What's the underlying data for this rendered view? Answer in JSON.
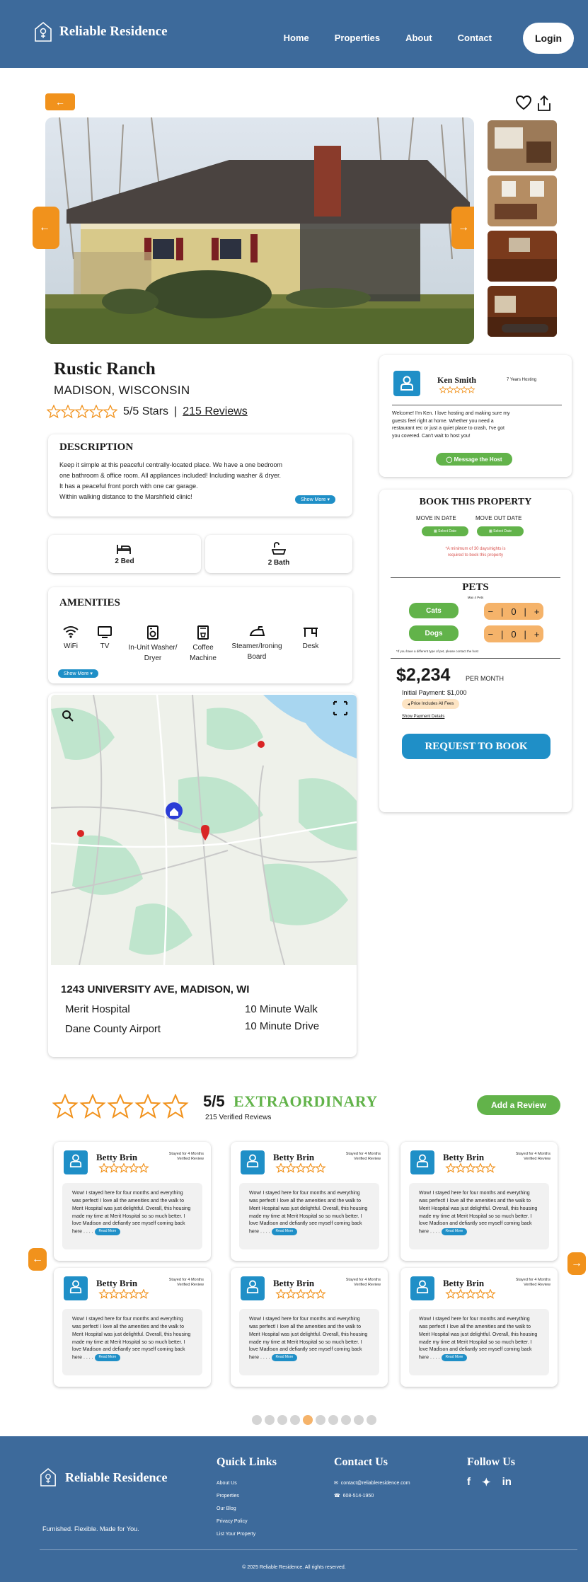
{
  "brand": "Reliable Residence",
  "nav": {
    "links": [
      "Home",
      "Properties",
      "About",
      "Contact"
    ],
    "login": "Login"
  },
  "property": {
    "name": "Rustic Ranch",
    "location": "MADISON, WISCONSIN",
    "stars_text": "5/5 Stars",
    "reviews_link": "215 Reviews",
    "rating": 5
  },
  "description": {
    "heading": "DESCRIPTION",
    "lines": [
      "Keep it simple at this peaceful centrally-located place. We have a one bedroom",
      "one bathroom & office room. All appliances included! Including washer & dryer.",
      "It has a peaceful front porch with one car garage.",
      "Within walking distance to the Marshfield clinic!"
    ],
    "show_more": "Show More"
  },
  "rooms": {
    "bed": "2 Bed",
    "bath": "2 Bath"
  },
  "amenities": {
    "heading": "AMENITIES",
    "items": [
      {
        "icon": "wifi-icon",
        "label": "WiFi"
      },
      {
        "icon": "tv-icon",
        "label": "TV"
      },
      {
        "icon": "washer-icon",
        "label": "In-Unit Washer/ Dryer"
      },
      {
        "icon": "coffee-machine-icon",
        "label": "Coffee Machine"
      },
      {
        "icon": "iron-icon",
        "label": "Steamer/Ironing Board"
      },
      {
        "icon": "desk-icon",
        "label": "Desk"
      }
    ],
    "show_more": "Show More"
  },
  "map": {
    "address": "1243 UNIVERSITY AVE, MADISON, WI",
    "places": [
      {
        "name": "Merit Hospital",
        "distance": "10 Minute Walk"
      },
      {
        "name": "Dane County Airport",
        "distance": "10 Minute Drive"
      }
    ]
  },
  "host": {
    "name": "Ken Smith",
    "hosting": "7 Years Hosting",
    "bio": [
      "Welcome! I'm Ken. I love hosting and making sure my",
      "guests feel right at home. Whether you need a",
      "restaurant rec or just a quiet place to crash, I've got",
      "you covered. Can't wait to host you!"
    ],
    "message": "Message the Host"
  },
  "booking": {
    "heading": "BOOK THIS PROPERTY",
    "move_in": "MOVE IN DATE",
    "move_out": "MOVE OUT DATE",
    "select_date": "Select Date",
    "minimum": [
      "*A minimum of 30 days/nights is",
      "required to book this property"
    ],
    "pets_heading": "PETS",
    "pets_sub": "Max 4 Pets",
    "pets": [
      {
        "label": "Cats",
        "count": "0"
      },
      {
        "label": "Dogs",
        "count": "0"
      }
    ],
    "pets_note": "*If you have a different type of pet, please contact the host",
    "price": "$2,234",
    "per": "PER MONTH",
    "initial": "Initial Payment: $1,000",
    "fees": "Price Includes All Fees",
    "payment_details": "Show Payment Details",
    "request": "REQUEST TO BOOK"
  },
  "reviews": {
    "score": "5/5",
    "label": "EXTRAORDINARY",
    "verified": "215 Verified Reviews",
    "add": "Add a Review",
    "cards": [
      {
        "name": "Betty Brin",
        "stay": "Stayed for 4 Months Verified Review",
        "text": "Wow! I stayed here for four months and everything was perfect! I love all the amenities and the walk to Merit Hospital was just delightful. Overall, this housing made my time at Merit Hospital so so much better. I love Madison and defiantly see myself coming back here . . . .",
        "more": "Read More"
      },
      {
        "name": "Betty Brin",
        "stay": "Stayed for 4 Months Verified Review",
        "text": "Wow! I stayed here for four months and everything was perfect! I love all the amenities and the walk to Merit Hospital was just delightful. Overall, this housing made my time at Merit Hospital so so much better. I love Madison and defiantly see myself coming back here . . . .",
        "more": "Read More"
      },
      {
        "name": "Betty Brin",
        "stay": "Stayed for 4 Months Verified Review",
        "text": "Wow! I stayed here for four months and everything was perfect! I love all the amenities and the walk to Merit Hospital was just delightful. Overall, this housing made my time at Merit Hospital so so much better. I love Madison and defiantly see myself coming back here . . . .",
        "more": "Read More"
      },
      {
        "name": "Betty Brin",
        "stay": "Stayed for 4 Months Verified Review",
        "text": "Wow! I stayed here for four months and everything was perfect! I love all the amenities and the walk to Merit Hospital was just delightful. Overall, this housing made my time at Merit Hospital so so much better. I love Madison and defiantly see myself coming back here . . . .",
        "more": "Read More"
      },
      {
        "name": "Betty Brin",
        "stay": "Stayed for 4 Months Verified Review",
        "text": "Wow! I stayed here for four months and everything was perfect! I love all the amenities and the walk to Merit Hospital was just delightful. Overall, this housing made my time at Merit Hospital so so much better. I love Madison and defiantly see myself coming back here . . . .",
        "more": "Read More"
      },
      {
        "name": "Betty Brin",
        "stay": "Stayed for 4 Months Verified Review",
        "text": "Wow! I stayed here for four months and everything was perfect! I love all the amenities and the walk to Merit Hospital was just delightful. Overall, this housing made my time at Merit Hospital so so much better. I love Madison and defiantly see myself coming back here . . . .",
        "more": "Read More"
      }
    ],
    "page_count": 10,
    "active_page": 4
  },
  "footer": {
    "tagline": "Furnished. Flexible. Made for You.",
    "quick_links_heading": "Quick Links",
    "quick_links": [
      "About Us",
      "Properties",
      "Our Blog",
      "Privacy Policy",
      "List Your Property"
    ],
    "contact_heading": "Contact Us",
    "email": "contact@reliableresidence.com",
    "phone": "608-514-1950",
    "follow_heading": "Follow Us",
    "copyright": "© 2025 Reliable Residence. All rights reserved."
  },
  "colors": {
    "navy": "#3d6a9b",
    "orange": "#f1921c",
    "blue": "#1f8fc7",
    "green": "#62b34a",
    "star": "#f1921c"
  }
}
